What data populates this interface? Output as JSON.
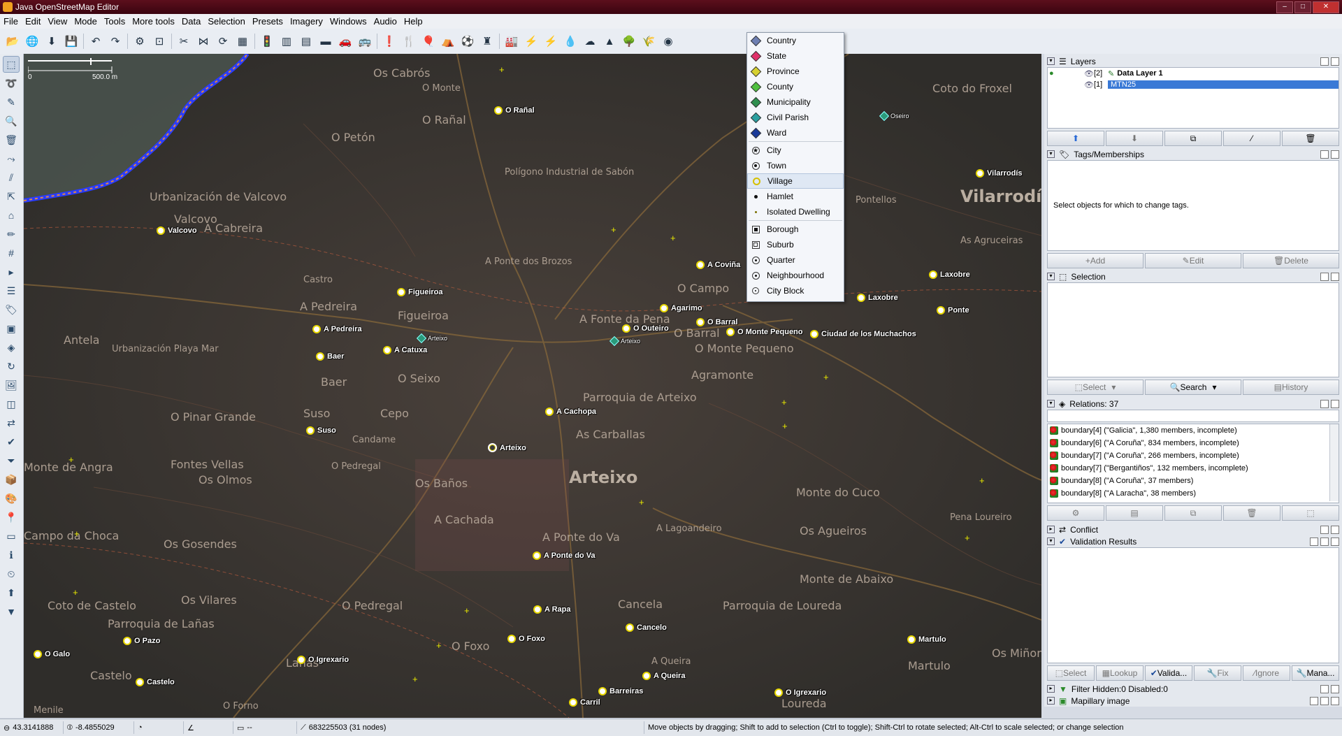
{
  "window": {
    "title": "Java OpenStreetMap Editor"
  },
  "menu": [
    "File",
    "Edit",
    "View",
    "Mode",
    "Tools",
    "More tools",
    "Data",
    "Selection",
    "Presets",
    "Imagery",
    "Windows",
    "Audio",
    "Help"
  ],
  "scale": {
    "zero": "0",
    "dist": "500.0 m"
  },
  "dropdown": {
    "group1": [
      {
        "label": "Country",
        "color": "#6e7fb2",
        "shape": "diamond"
      },
      {
        "label": "State",
        "color": "#e0306a",
        "shape": "diamond"
      },
      {
        "label": "Province",
        "color": "#d6d030",
        "shape": "diamond"
      },
      {
        "label": "County",
        "color": "#50c040",
        "shape": "diamond"
      },
      {
        "label": "Municipality",
        "color": "#2f8f4f",
        "shape": "diamond"
      },
      {
        "label": "Civil Parish",
        "color": "#2aa0a0",
        "shape": "diamond"
      },
      {
        "label": "Ward",
        "color": "#1a3a9a",
        "shape": "diamond"
      }
    ],
    "group2": [
      {
        "label": "City",
        "shape": "star"
      },
      {
        "label": "Town",
        "shape": "ring-dot"
      },
      {
        "label": "Village",
        "shape": "ring-yellow",
        "highlight": true
      },
      {
        "label": "Hamlet",
        "shape": "dot"
      },
      {
        "label": "Isolated Dwelling",
        "shape": "smalldot"
      }
    ],
    "group3": [
      {
        "label": "Borough",
        "shape": "square"
      },
      {
        "label": "Suburb",
        "shape": "square-ring"
      },
      {
        "label": "Quarter",
        "shape": "ring-dot"
      },
      {
        "label": "Neighbourhood",
        "shape": "ring-dot"
      },
      {
        "label": "City Block",
        "shape": "ring-small"
      }
    ]
  },
  "map": {
    "bg_labels": [
      {
        "t": "Os Cabrós",
        "cls": "med"
      },
      {
        "t": "O Monte",
        "cls": "sm"
      },
      {
        "t": "O Rañal",
        "cls": "med"
      },
      {
        "t": "O Petón",
        "cls": "med"
      },
      {
        "t": "Polígono Industrial de Sabón",
        "cls": "sm"
      },
      {
        "t": "Urbanización de Valcovo",
        "cls": "med"
      },
      {
        "t": "Valcovo",
        "cls": "med"
      },
      {
        "t": "A Cabreira",
        "cls": "med"
      },
      {
        "t": "Castro",
        "cls": "sm"
      },
      {
        "t": "A Pedreira",
        "cls": "med"
      },
      {
        "t": "Figueiroa",
        "cls": "med"
      },
      {
        "t": "A Ponte dos Brozos",
        "cls": "sm"
      },
      {
        "t": "O Campo",
        "cls": "med"
      },
      {
        "t": "A Fonte da Pena",
        "cls": "med"
      },
      {
        "t": "O Barral",
        "cls": "med"
      },
      {
        "t": "O Monte Pequeno",
        "cls": "med"
      },
      {
        "t": "Urbanización Playa Mar",
        "cls": "sm"
      },
      {
        "t": "Antela",
        "cls": "med"
      },
      {
        "t": "O Seixo",
        "cls": "med"
      },
      {
        "t": "Baer",
        "cls": "med"
      },
      {
        "t": "Agramonte",
        "cls": "med"
      },
      {
        "t": "Parroquia de Arteixo",
        "cls": "med"
      },
      {
        "t": "O Pinar Grande",
        "cls": "med"
      },
      {
        "t": "Cepo",
        "cls": "med"
      },
      {
        "t": "As Carballas",
        "cls": "med"
      },
      {
        "t": "Suso",
        "cls": "med"
      },
      {
        "t": "Candame",
        "cls": "sm"
      },
      {
        "t": "O Pedregal",
        "cls": "sm"
      },
      {
        "t": "Arteixo",
        "cls": "big"
      },
      {
        "t": "Monte de Angra",
        "cls": "med"
      },
      {
        "t": "Fontes Vellas",
        "cls": "med"
      },
      {
        "t": "Os Olmos",
        "cls": "med"
      },
      {
        "t": "Os Baños",
        "cls": "med"
      },
      {
        "t": "A Cachada",
        "cls": "med"
      },
      {
        "t": "Monte do Cuco",
        "cls": "med"
      },
      {
        "t": "Campo da Choca",
        "cls": "med"
      },
      {
        "t": "Os Gosendes",
        "cls": "med"
      },
      {
        "t": "A Lagoandeiro",
        "cls": "sm"
      },
      {
        "t": "Os Agueiros",
        "cls": "med"
      },
      {
        "t": "A Ponte do Va",
        "cls": "med"
      },
      {
        "t": "Coto de Castelo",
        "cls": "med"
      },
      {
        "t": "Os Vilares",
        "cls": "med"
      },
      {
        "t": "O Pedregal",
        "cls": "med"
      },
      {
        "t": "Parroquia de Lañas",
        "cls": "med"
      },
      {
        "t": "Cancela",
        "cls": "med"
      },
      {
        "t": "Parroquia de Loureda",
        "cls": "med"
      },
      {
        "t": "Monte de Abaixo",
        "cls": "med"
      },
      {
        "t": "Lañas",
        "cls": "med"
      },
      {
        "t": "Castelo",
        "cls": "med"
      },
      {
        "t": "O Foxo",
        "cls": "med"
      },
      {
        "t": "A Queira",
        "cls": "sm"
      },
      {
        "t": "Loureda",
        "cls": "med"
      },
      {
        "t": "Os Miñons",
        "cls": "med"
      },
      {
        "t": "Vilarrodís",
        "cls": "big"
      },
      {
        "t": "Coto do Froxel",
        "cls": "med"
      },
      {
        "t": "Pontellos",
        "cls": "sm"
      },
      {
        "t": "As Agruceiras",
        "cls": "sm"
      },
      {
        "t": "Pena Loureiro",
        "cls": "sm"
      },
      {
        "t": "Martulo",
        "cls": "med"
      },
      {
        "t": "O Forno",
        "cls": "sm"
      },
      {
        "t": "Menile",
        "cls": "sm"
      }
    ],
    "nodes": [
      {
        "t": "O Rañal"
      },
      {
        "t": "Valcovo"
      },
      {
        "t": "Figueiroa"
      },
      {
        "t": "A Pedreira"
      },
      {
        "t": "A Catuxa"
      },
      {
        "t": "Baer"
      },
      {
        "t": "Suso"
      },
      {
        "t": "A Coviña"
      },
      {
        "t": "Agarimo"
      },
      {
        "t": "O Outeiro"
      },
      {
        "t": "O Barral"
      },
      {
        "t": "O Monte Pequeno"
      },
      {
        "t": "Ciudad de los Muchachos"
      },
      {
        "t": "A Cachopa"
      },
      {
        "t": "Arteixo",
        "town": true
      },
      {
        "t": "A Ponte do Va"
      },
      {
        "t": "A Rapa"
      },
      {
        "t": "O Foxo"
      },
      {
        "t": "Cancelo"
      },
      {
        "t": "A Queira"
      },
      {
        "t": "Barreiras"
      },
      {
        "t": "Carril"
      },
      {
        "t": "O Igrexario"
      },
      {
        "t": "O Pazo"
      },
      {
        "t": "O Galo"
      },
      {
        "t": "Castelo"
      },
      {
        "t": "O Igrexario"
      },
      {
        "t": "Martulo"
      },
      {
        "t": "Laxobre"
      },
      {
        "t": "Laxobre"
      },
      {
        "t": "Ponte"
      },
      {
        "t": "Vilarrodís"
      }
    ],
    "diamonds": [
      {
        "t": "Arteixo"
      },
      {
        "t": "Arteixo"
      },
      {
        "t": "Oseiro"
      }
    ]
  },
  "panels": {
    "layers": {
      "title": "Layers",
      "rows": [
        {
          "idx": "[2]",
          "name": "Data Layer 1",
          "bold": true
        },
        {
          "idx": "[1]",
          "name": "MTN25",
          "selected": true
        }
      ]
    },
    "tags": {
      "title": "Tags/Memberships",
      "empty": "Select objects for which to change tags.",
      "buttons": [
        "Add",
        "Edit",
        "Delete"
      ]
    },
    "selection": {
      "title": "Selection",
      "buttons": [
        "Select",
        "Search",
        "History"
      ]
    },
    "relations": {
      "title": "Relations: 37",
      "rows": [
        "boundary[4] (\"Galicia\", 1,380 members, incomplete)",
        "boundary[6] (\"A Coruña\", 834 members, incomplete)",
        "boundary[7] (\"A Coruña\", 266 members, incomplete)",
        "boundary[7] (\"Bergantiños\", 132 members, incomplete)",
        "boundary[8] (\"A Coruña\", 37 members)",
        "boundary[8] (\"A Laracha\", 38 members)"
      ]
    },
    "conflict": {
      "title": "Conflict"
    },
    "validation": {
      "title": "Validation Results",
      "buttons": [
        "Select",
        "Lookup",
        "Valida...",
        "Fix",
        "Ignore",
        "Mana..."
      ]
    },
    "filter": {
      "title": "Filter Hidden:0 Disabled:0"
    },
    "mapillary": {
      "title": "Mapillary image"
    }
  },
  "status": {
    "lat": "43.3141888",
    "lon": "-8.4855029",
    "heading": "",
    "angle": "",
    "length": "--",
    "selected": "683225503 (31 nodes)",
    "help": "Move objects by dragging; Shift to add to selection (Ctrl to toggle); Shift-Ctrl to rotate selected; Alt-Ctrl to scale selected; or change selection"
  }
}
